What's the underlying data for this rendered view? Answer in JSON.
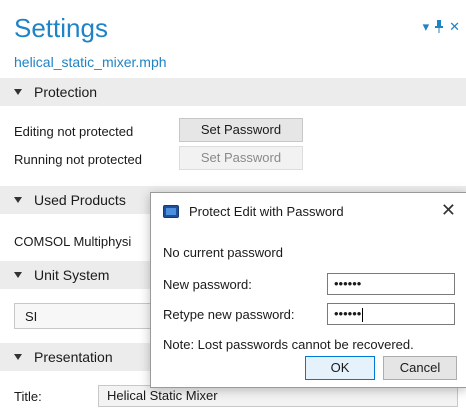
{
  "panel": {
    "title": "Settings",
    "subtitle": "helical_static_mixer.mph"
  },
  "protection": {
    "header": "Protection",
    "editing_status": "Editing not protected",
    "running_status": "Running not protected",
    "set_password_label": "Set Password",
    "set_password_running_label": "Set Password"
  },
  "used_products": {
    "header": "Used Products",
    "item": "COMSOL Multiphysi"
  },
  "unit_system": {
    "header": "Unit System",
    "value": "SI"
  },
  "presentation": {
    "header": "Presentation",
    "title_label": "Title:",
    "title_value": "Helical Static Mixer"
  },
  "dialog": {
    "title": "Protect Edit with Password",
    "current_status": "No current password",
    "new_password_label": "New password:",
    "new_password_value": "••••••",
    "retype_label": "Retype new password:",
    "retype_value": "••••••",
    "note": "Note: Lost passwords cannot be recovered.",
    "ok_label": "OK",
    "cancel_label": "Cancel",
    "close_glyph": "✕"
  },
  "icons": {
    "window_controls": [
      "chevron-down-icon",
      "pin-icon",
      "close-icon"
    ],
    "dialog_icon": "window-icon"
  },
  "colors": {
    "accent": "#1f83c6",
    "section_bg": "#ececec",
    "dialog_default_border": "#0078d7"
  }
}
